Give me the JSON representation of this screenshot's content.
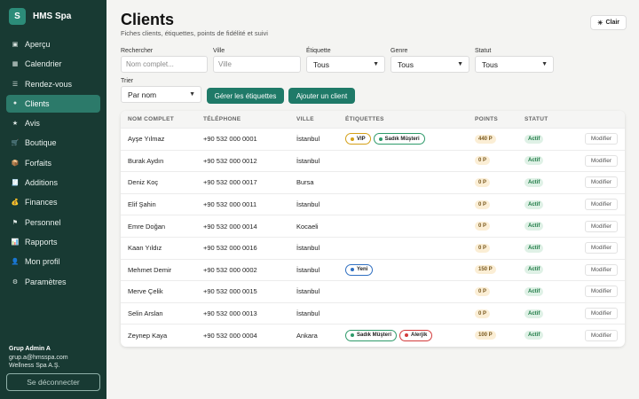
{
  "brand": {
    "logo_letter": "S",
    "name": "HMS Spa"
  },
  "nav": [
    {
      "label": "Aperçu",
      "icon": "▣",
      "icon_name": "overview-icon",
      "active": false
    },
    {
      "label": "Calendrier",
      "icon": "▦",
      "icon_name": "calendar-icon",
      "active": false
    },
    {
      "label": "Rendez-vous",
      "icon": "☰",
      "icon_name": "list-icon",
      "active": false
    },
    {
      "label": "Clients",
      "icon": "●",
      "icon_name": "user-icon",
      "active": true
    },
    {
      "label": "Avis",
      "icon": "★",
      "icon_name": "star-icon",
      "active": false
    },
    {
      "label": "Boutique",
      "icon": "🛒",
      "icon_name": "cart-icon",
      "active": false
    },
    {
      "label": "Forfaits",
      "icon": "📦",
      "icon_name": "package-icon",
      "active": false
    },
    {
      "label": "Additions",
      "icon": "🧾",
      "icon_name": "receipt-icon",
      "active": false
    },
    {
      "label": "Finances",
      "icon": "💰",
      "icon_name": "money-icon",
      "active": false
    },
    {
      "label": "Personnel",
      "icon": "⚑",
      "icon_name": "staff-icon",
      "active": false
    },
    {
      "label": "Rapports",
      "icon": "📊",
      "icon_name": "chart-icon",
      "active": false
    },
    {
      "label": "Mon profil",
      "icon": "👤",
      "icon_name": "profile-icon",
      "active": false
    },
    {
      "label": "Paramètres",
      "icon": "⚙",
      "icon_name": "gear-icon",
      "active": false
    }
  ],
  "user": {
    "name": "Grup Admin A",
    "email": "grup.a@hmsspa.com",
    "company": "Wellness Spa A.Ş."
  },
  "logout_label": "Se déconnecter",
  "header": {
    "title": "Clients",
    "subtitle": "Fiches clients, étiquettes, points de fidélité et suivi",
    "theme_icon": "☀",
    "theme_label": "Clair"
  },
  "filters": {
    "search": {
      "label": "Rechercher",
      "placeholder": "Nom complet..."
    },
    "city": {
      "label": "Ville",
      "placeholder": "Ville"
    },
    "tag": {
      "label": "Étiquette",
      "value": "Tous"
    },
    "gender": {
      "label": "Genre",
      "value": "Tous"
    },
    "status": {
      "label": "Statut",
      "value": "Tous"
    },
    "sort": {
      "label": "Trier",
      "value": "Par nom"
    }
  },
  "actions": {
    "manage_tags": "Gérer les étiquettes",
    "add_client": "Ajouter un client"
  },
  "table": {
    "columns": [
      "NOM COMPLET",
      "TÉLÉPHONE",
      "VILLE",
      "ÉTIQUETTES",
      "POINTS",
      "STATUT",
      ""
    ],
    "rows": [
      {
        "name": "Ayşe Yılmaz",
        "phone": "+90 532 000 0001",
        "city": "İstanbul",
        "tags": [
          {
            "label": "VIP",
            "color": "#d4a017"
          },
          {
            "label": "Sadık Müşteri",
            "color": "#2e9a6a"
          }
        ],
        "points": "440 P",
        "status": "Actif",
        "action": "Modifier"
      },
      {
        "name": "Burak Aydın",
        "phone": "+90 532 000 0012",
        "city": "İstanbul",
        "tags": [],
        "points": "0 P",
        "status": "Actif",
        "action": "Modifier"
      },
      {
        "name": "Deniz Koç",
        "phone": "+90 532 000 0017",
        "city": "Bursa",
        "tags": [],
        "points": "0 P",
        "status": "Actif",
        "action": "Modifier"
      },
      {
        "name": "Elif Şahin",
        "phone": "+90 532 000 0011",
        "city": "İstanbul",
        "tags": [],
        "points": "0 P",
        "status": "Actif",
        "action": "Modifier"
      },
      {
        "name": "Emre Doğan",
        "phone": "+90 532 000 0014",
        "city": "Kocaeli",
        "tags": [],
        "points": "0 P",
        "status": "Actif",
        "action": "Modifier"
      },
      {
        "name": "Kaan Yıldız",
        "phone": "+90 532 000 0016",
        "city": "İstanbul",
        "tags": [],
        "points": "0 P",
        "status": "Actif",
        "action": "Modifier"
      },
      {
        "name": "Mehmet Demir",
        "phone": "+90 532 000 0002",
        "city": "İstanbul",
        "tags": [
          {
            "label": "Yeni",
            "color": "#2f6fc1"
          }
        ],
        "points": "150 P",
        "status": "Actif",
        "action": "Modifier"
      },
      {
        "name": "Merve Çelik",
        "phone": "+90 532 000 0015",
        "city": "İstanbul",
        "tags": [],
        "points": "0 P",
        "status": "Actif",
        "action": "Modifier"
      },
      {
        "name": "Selin Arslan",
        "phone": "+90 532 000 0013",
        "city": "İstanbul",
        "tags": [],
        "points": "0 P",
        "status": "Actif",
        "action": "Modifier"
      },
      {
        "name": "Zeynep Kaya",
        "phone": "+90 532 000 0004",
        "city": "Ankara",
        "tags": [
          {
            "label": "Sadık Müşteri",
            "color": "#2e9a6a"
          },
          {
            "label": "Alerjik",
            "color": "#d33b3b"
          }
        ],
        "points": "100 P",
        "status": "Actif",
        "action": "Modifier"
      }
    ]
  }
}
